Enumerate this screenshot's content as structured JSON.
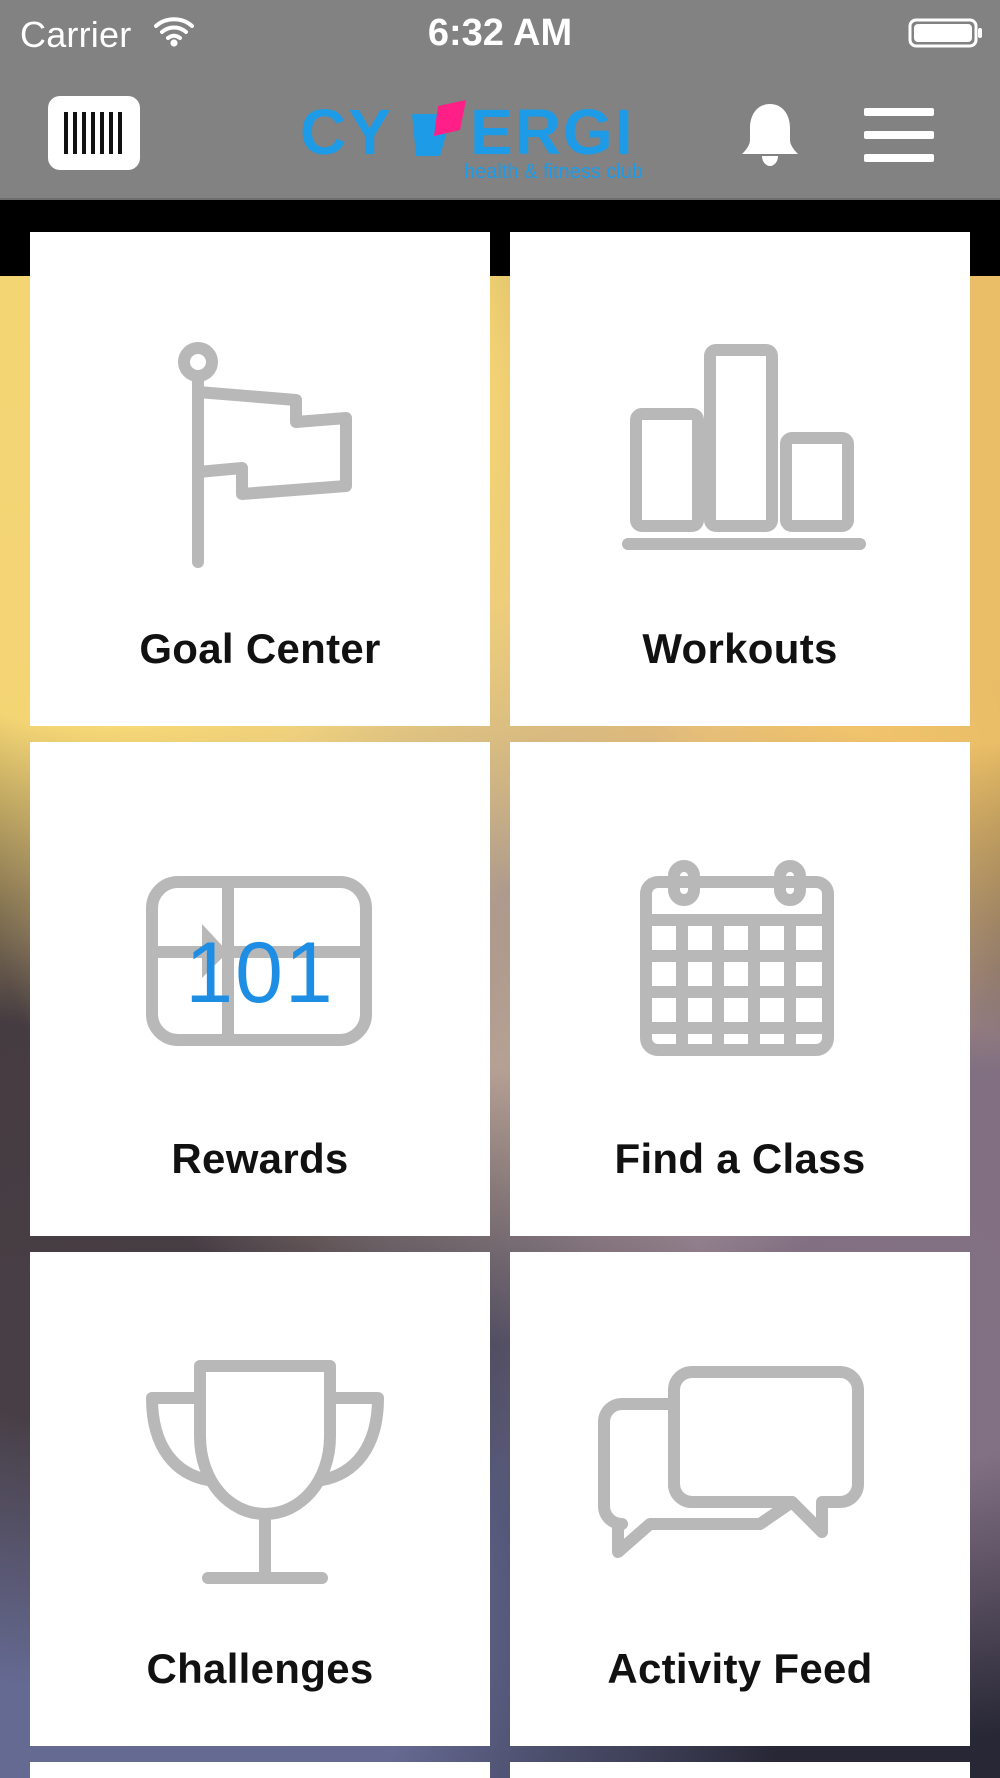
{
  "status_bar": {
    "carrier": "Carrier",
    "time": "6:32 AM"
  },
  "header": {
    "logo_text": "CYNERGI",
    "logo_subtext": "health & fitness club",
    "barcode_icon": "barcode-icon",
    "bell_icon": "bell-icon",
    "menu_icon": "hamburger-icon"
  },
  "tiles": [
    {
      "label": "Goal Center",
      "icon": "flag-icon"
    },
    {
      "label": "Workouts",
      "icon": "bar-chart-icon"
    },
    {
      "label": "Rewards",
      "icon": "gift-card-icon",
      "badge_value": "101"
    },
    {
      "label": "Find a Class",
      "icon": "calendar-icon"
    },
    {
      "label": "Challenges",
      "icon": "trophy-icon"
    },
    {
      "label": "Activity Feed",
      "icon": "chat-bubbles-icon"
    }
  ],
  "colors": {
    "header_gray": "#828282",
    "tile_white": "#ffffff",
    "icon_gray": "#b8b8b8",
    "logo_blue": "#1e9be6",
    "logo_pink": "#ff1f86",
    "badge_blue": "#1e8ee5"
  }
}
